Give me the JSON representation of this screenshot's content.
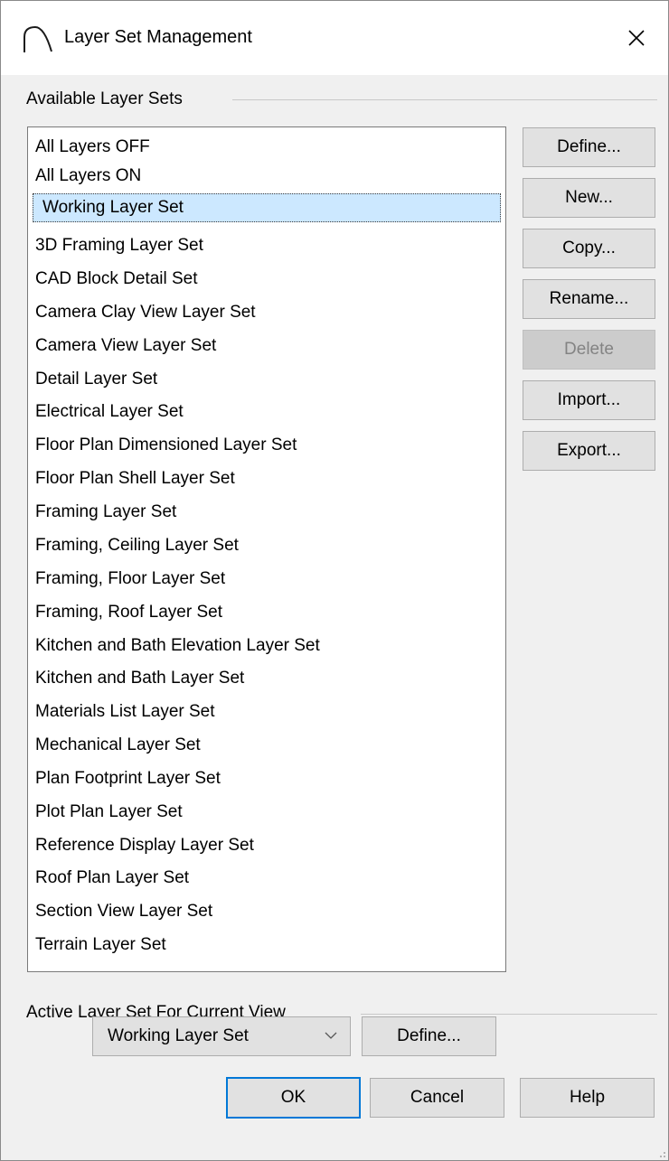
{
  "window": {
    "title": "Layer Set Management",
    "close_icon": "close-icon",
    "app_icon": "arc-logo-icon"
  },
  "available_group": {
    "label": "Available Layer Sets",
    "items": [
      "All Layers OFF",
      "All Layers ON",
      "Working Layer Set",
      "3D Framing Layer Set",
      "CAD Block Detail Set",
      "Camera Clay View Layer Set",
      "Camera View Layer Set",
      "Detail Layer Set",
      "Electrical Layer Set",
      "Floor Plan Dimensioned Layer Set",
      "Floor Plan Shell Layer Set",
      "Framing Layer Set",
      "Framing, Ceiling Layer Set",
      "Framing, Floor Layer Set",
      "Framing, Roof Layer Set",
      "Kitchen and Bath Elevation Layer Set",
      "Kitchen and Bath Layer Set",
      "Materials List Layer Set",
      "Mechanical Layer Set",
      "Plan Footprint Layer Set",
      "Plot Plan Layer Set",
      "Reference Display Layer Set",
      "Roof Plan Layer Set",
      "Section View Layer Set",
      "Terrain Layer Set"
    ],
    "selected_item": "Working Layer Set"
  },
  "side_buttons": {
    "define": "Define...",
    "new": "New...",
    "copy": "Copy...",
    "rename": "Rename...",
    "delete": "Delete",
    "import": "Import...",
    "export": "Export..."
  },
  "active_group": {
    "label": "Active Layer Set For Current View",
    "selected_value": "Working Layer Set",
    "define_label": "Define..."
  },
  "footer": {
    "ok": "OK",
    "cancel": "Cancel",
    "help": "Help"
  },
  "colors": {
    "selection_bg": "#cce8ff",
    "default_button_border": "#0078d7",
    "dialog_bg": "#f0f0f0"
  }
}
